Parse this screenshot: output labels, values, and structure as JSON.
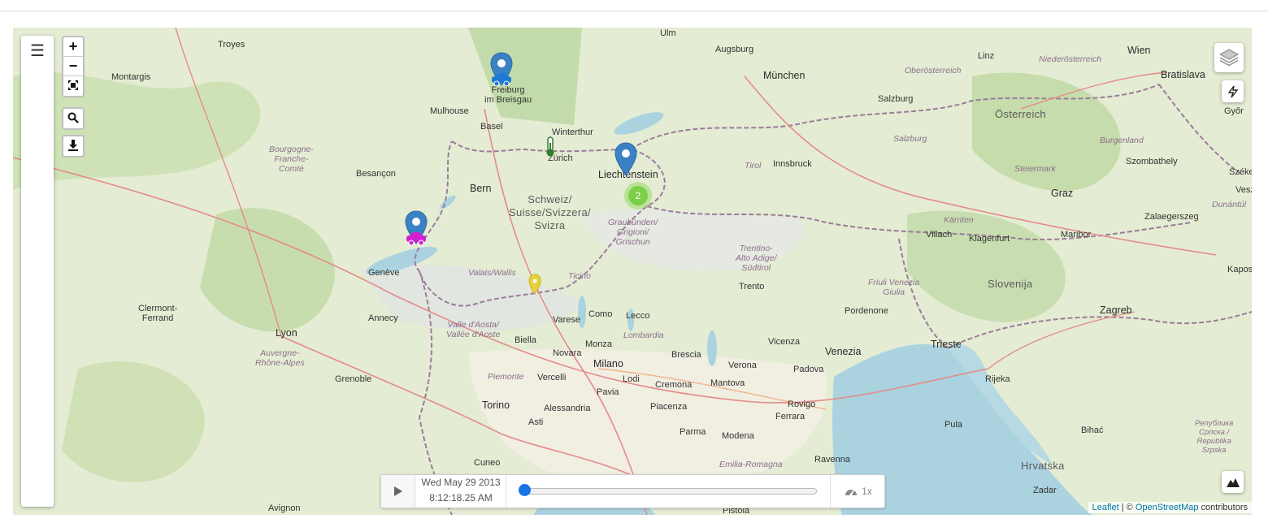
{
  "map": {
    "labels": {
      "troyes": "Troyes",
      "montargis": "Montargis",
      "mulhouse": "Mulhouse",
      "basel": "Basel",
      "freiburg": "Freiburg\nim Breisgau",
      "ulm": "Ulm",
      "augsburg": "Augsburg",
      "munchen": "München",
      "linz": "Linz",
      "wien": "Wien",
      "bratislava": "Bratislava",
      "gyor": "Győr",
      "niederosterreich": "Niederösterreich",
      "oberosterreich": "Oberösterreich",
      "salzburg_city": "Salzburg",
      "salzburg_region": "Salzburg",
      "osterreich": "Österreich",
      "burgenland": "Burgenland",
      "szombathely": "Szombathely",
      "steiermark": "Steiermark",
      "graz": "Graz",
      "szeke": "Széke",
      "vesz": "Vesz",
      "dunantul": "Dunántúl",
      "zalaegerszeg": "Zalaegerszeg",
      "winterthur": "Winterthur",
      "zurich": "Zürich",
      "liechtenstein": "Liechtenstein",
      "tirol": "Tirol",
      "innsbruck": "Innsbruck",
      "bourgogne": "Bourgogne-\nFranche-\nComté",
      "besancon": "Besançon",
      "bern": "Bern",
      "schweiz": "Schweiz/\nSuisse/Svizzera/\nSvizra",
      "graubunden": "Graubünden/\nGrigioni/\nGrischun",
      "karnten": "Kärnten",
      "villach": "Villach",
      "klagenfurt": "Klagenfurt",
      "maribor": "Maribor",
      "kaposv": "Kaposv",
      "geneve": "Genève",
      "valais": "Valais/Wallis",
      "ticino": "Ticino",
      "trentino": "Trentino-\nAlto Adige/\nSüdtirol",
      "trento": "Trento",
      "friuli": "Friuli Venezia\nGiulia",
      "slovenija": "Slovenija",
      "zagreb": "Zagreb",
      "clermont": "Clermont-\nFerrand",
      "lyon": "Lyon",
      "annecy": "Annecy",
      "auvergne": "Auvergne-\nRhône-Alpes",
      "grenoble": "Grenoble",
      "como": "Como",
      "lecco": "Lecco",
      "pordenone": "Pordenone",
      "valle": "Valle d'Aosta/\nVallée d'Aoste",
      "varese": "Varese",
      "lombardia": "Lombardia",
      "biella": "Biella",
      "monza": "Monza",
      "brescia": "Brescia",
      "vicenza": "Vicenza",
      "venezia": "Venezia",
      "trieste": "Trieste",
      "novara": "Novara",
      "milano": "Milano",
      "verona": "Verona",
      "padova": "Padova",
      "rijeka": "Rijeka",
      "piemonte": "Piemonte",
      "vercelli": "Vercelli",
      "lodi": "Lodi",
      "cremona": "Cremona",
      "mantova": "Mantova",
      "pavia": "Pavia",
      "rovigo": "Rovigo",
      "torino": "Torino",
      "alessandria": "Alessandria",
      "piacenza": "Piacenza",
      "ferrara": "Ferrara",
      "pula": "Pula",
      "asti": "Asti",
      "parma": "Parma",
      "modena": "Modena",
      "bihac": "Bihać",
      "hrvatska": "Hrvatska",
      "cuneo": "Cuneo",
      "emilia": "Emilia-Romagna",
      "ravenna": "Ravenna",
      "zadar": "Zadar",
      "republika": "Република\nСрпска /\nRepublika\nSrpska",
      "avignon": "Avignon",
      "pistoia": "Pistoia"
    },
    "cluster_count": "2"
  },
  "controls": {
    "zoom_in": "+",
    "zoom_out": "−"
  },
  "player": {
    "date": "Wed May 29 2013",
    "time": "8:12:18.25 AM",
    "progress": 0.0,
    "speed": "1x"
  },
  "attribution": {
    "leaflet": "Leaflet",
    "separator": " | © ",
    "osm": "OpenStreetMap",
    "contributors": " contributors"
  },
  "colors": {
    "marker_blue": "#3a82c4",
    "vehicle_blue": "#1e78d6",
    "vehicle_magenta": "#d21fd2",
    "thermometer_green": "#2f7d2f",
    "pin_yellow": "#e6d23a",
    "cluster_green": "#6ecc39"
  }
}
